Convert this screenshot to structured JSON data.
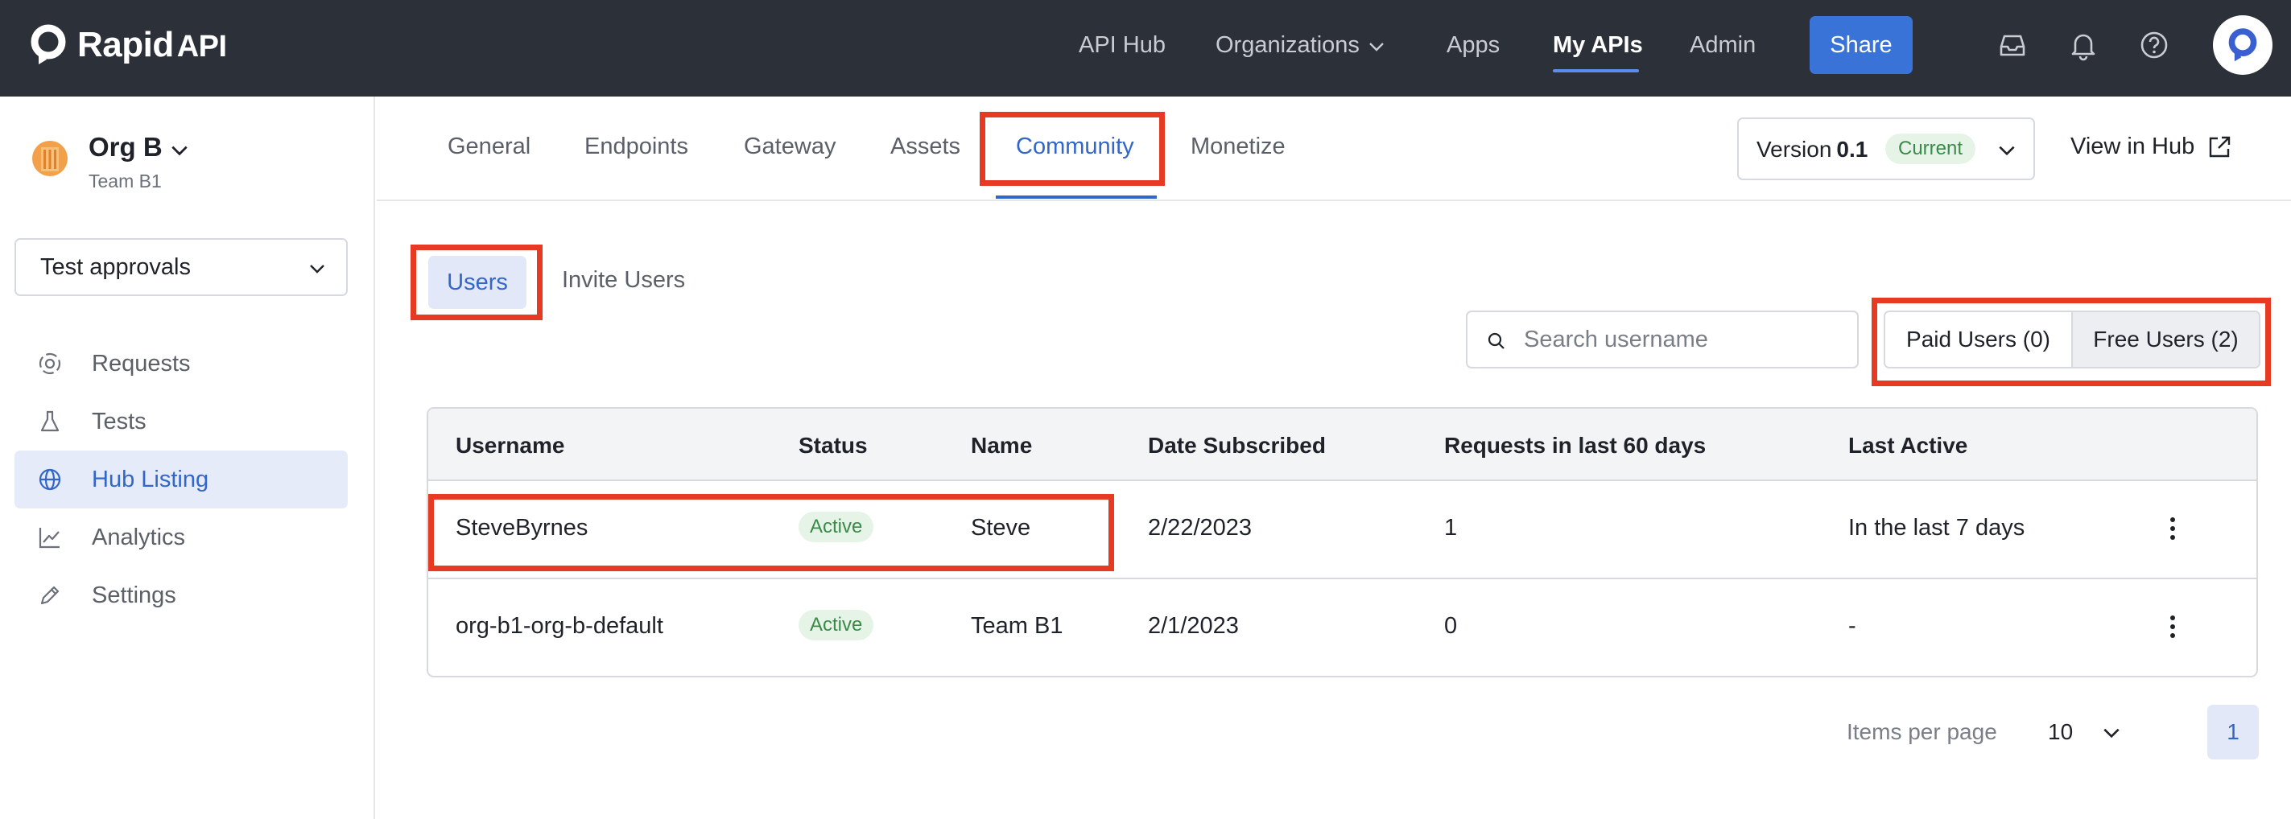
{
  "topnav": {
    "logo_text": "Rapid",
    "logo_suffix": "API",
    "links": [
      "API Hub",
      "Organizations",
      "Apps",
      "My APIs",
      "Admin"
    ],
    "active_link": "My APIs",
    "share_label": "Share"
  },
  "sidebar": {
    "org_name": "Org B",
    "team_name": "Team B1",
    "project_select": "Test approvals",
    "items": [
      {
        "label": "Requests",
        "icon": "requests-icon"
      },
      {
        "label": "Tests",
        "icon": "flask-icon"
      },
      {
        "label": "Hub Listing",
        "icon": "globe-icon"
      },
      {
        "label": "Analytics",
        "icon": "chart-icon"
      },
      {
        "label": "Settings",
        "icon": "pencil-icon"
      }
    ],
    "active_item": "Hub Listing"
  },
  "tabs": {
    "items": [
      "General",
      "Endpoints",
      "Gateway",
      "Assets",
      "Community",
      "Monetize"
    ],
    "active": "Community"
  },
  "version": {
    "label": "Version",
    "number": "0.1",
    "badge": "Current"
  },
  "view_in_hub": "View in Hub",
  "subtabs": {
    "users": "Users",
    "invite": "Invite Users"
  },
  "search": {
    "placeholder": "Search username",
    "value": ""
  },
  "filter": {
    "paid": "Paid Users (0)",
    "free": "Free Users (2)",
    "selected": "Free Users (2)"
  },
  "table": {
    "headers": [
      "Username",
      "Status",
      "Name",
      "Date Subscribed",
      "Requests in last 60 days",
      "Last Active"
    ],
    "rows": [
      {
        "username": "SteveByrnes",
        "status": "Active",
        "name": "Steve",
        "date": "2/22/2023",
        "requests": "1",
        "last_active": "In the last 7 days"
      },
      {
        "username": "org-b1-org-b-default",
        "status": "Active",
        "name": "Team B1",
        "date": "2/1/2023",
        "requests": "0",
        "last_active": "-"
      }
    ]
  },
  "pagination": {
    "items_per_page_label": "Items per page",
    "items_per_page": "10",
    "current_page": "1"
  },
  "colors": {
    "topbar": "#2c3038",
    "accent": "#3266c8",
    "share": "#3a73d8",
    "highlight": "#e63a23",
    "active_badge_bg": "#e6f4e8",
    "active_badge_text": "#3a8a4a"
  }
}
